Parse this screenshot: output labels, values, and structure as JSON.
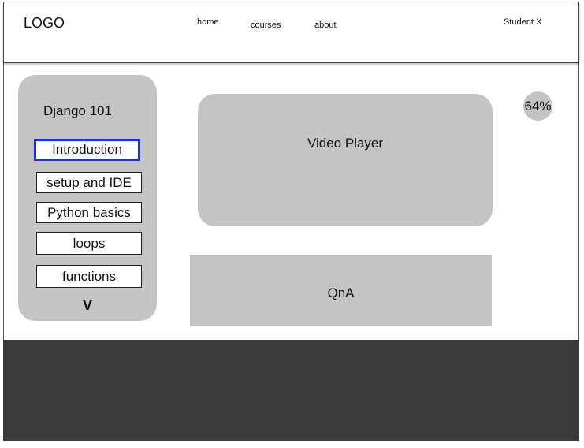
{
  "header": {
    "logo": "LOGO",
    "nav": [
      "home",
      "courses",
      "about"
    ],
    "user": "Student X"
  },
  "sidebar": {
    "course_title": "Django 101",
    "lessons": [
      "Introduction",
      "setup and IDE",
      "Python basics",
      "loops",
      "functions"
    ],
    "active_lesson": "Introduction",
    "more_indicator": "V"
  },
  "main": {
    "video_label": "Video Player",
    "qna_label": "QnA"
  },
  "progress": {
    "label": "64%",
    "value_percent": 64
  },
  "colors": {
    "panel": "#c4c4c4",
    "active_border": "#1531e6",
    "footer": "#3a3a3a"
  }
}
